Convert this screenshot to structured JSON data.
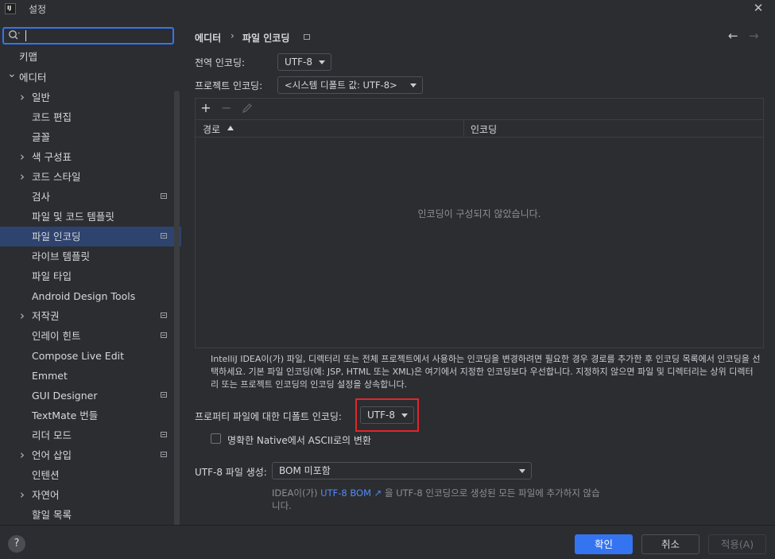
{
  "window": {
    "title": "설정"
  },
  "search": {
    "value": ""
  },
  "sidebar": {
    "items": [
      {
        "label": "키맵",
        "chevron": ""
      },
      {
        "label": "에디터",
        "chevron": "down"
      },
      {
        "label": "일반",
        "chevron": "right"
      },
      {
        "label": "코드 편집",
        "chevron": ""
      },
      {
        "label": "글꼴",
        "chevron": ""
      },
      {
        "label": "색 구성표",
        "chevron": "right"
      },
      {
        "label": "코드 스타일",
        "chevron": "right"
      },
      {
        "label": "검사",
        "chevron": ""
      },
      {
        "label": "파일 및 코드 템플릿",
        "chevron": ""
      },
      {
        "label": "파일 인코딩",
        "chevron": ""
      },
      {
        "label": "라이브 템플릿",
        "chevron": ""
      },
      {
        "label": "파일 타입",
        "chevron": ""
      },
      {
        "label": "Android Design Tools",
        "chevron": ""
      },
      {
        "label": "저작권",
        "chevron": "right"
      },
      {
        "label": "인레이 힌트",
        "chevron": ""
      },
      {
        "label": "Compose Live Edit",
        "chevron": ""
      },
      {
        "label": "Emmet",
        "chevron": ""
      },
      {
        "label": "GUI Designer",
        "chevron": ""
      },
      {
        "label": "TextMate 번들",
        "chevron": ""
      },
      {
        "label": "리더 모드",
        "chevron": ""
      },
      {
        "label": "언어 삽입",
        "chevron": "right"
      },
      {
        "label": "인텐션",
        "chevron": ""
      },
      {
        "label": "자연어",
        "chevron": "right"
      },
      {
        "label": "할일 목록",
        "chevron": ""
      }
    ]
  },
  "breadcrumb": {
    "parent": "에디터",
    "separator": "›",
    "current": "파일 인코딩"
  },
  "form": {
    "global_label": "전역 인코딩:",
    "global_value": "UTF-8",
    "project_label": "프로젝트 인코딩:",
    "project_value": "<시스템 디폴트 값: UTF-8>",
    "table": {
      "col_path": "경로",
      "col_encoding": "인코딩",
      "empty": "인코딩이 구성되지 않았습니다."
    },
    "help_text": "IntelliJ IDEA이(가) 파일, 디렉터리 또는 전체 프로젝트에서 사용하는 인코딩을 변경하려면 필요한 경우 경로를 추가한 후 인코딩 목록에서 인코딩을 선택하세요. 기본 파일 인코딩(예: JSP, HTML 또는 XML)은 여기에서 지정한 인코딩보다 우선합니다. 지정하지 않으면 파일 및 디렉터리는 상위 디렉터리 또는 프로젝트 인코딩의 인코딩 설정을 상속합니다.",
    "properties_label": "프로퍼티 파일에 대한 디폴트 인코딩:",
    "properties_value": "UTF-8",
    "native_ascii_label": "명확한 Native에서 ASCII로의 변환",
    "bom_label": "UTF-8 파일 생성:",
    "bom_value": "BOM 미포함",
    "bom_note_before": "IDEA이(가) ",
    "bom_note_link": "UTF-8 BOM ↗",
    "bom_note_after": " 을 UTF-8 인코딩으로 생성된 모든 파일에 추가하지 않습니다."
  },
  "footer": {
    "help": "?",
    "ok": "확인",
    "cancel": "취소",
    "apply": "적용(A)"
  },
  "colors": {
    "accent": "#3574f0",
    "selection": "#2e436e",
    "highlight": "#e0262b",
    "link": "#548af7"
  }
}
